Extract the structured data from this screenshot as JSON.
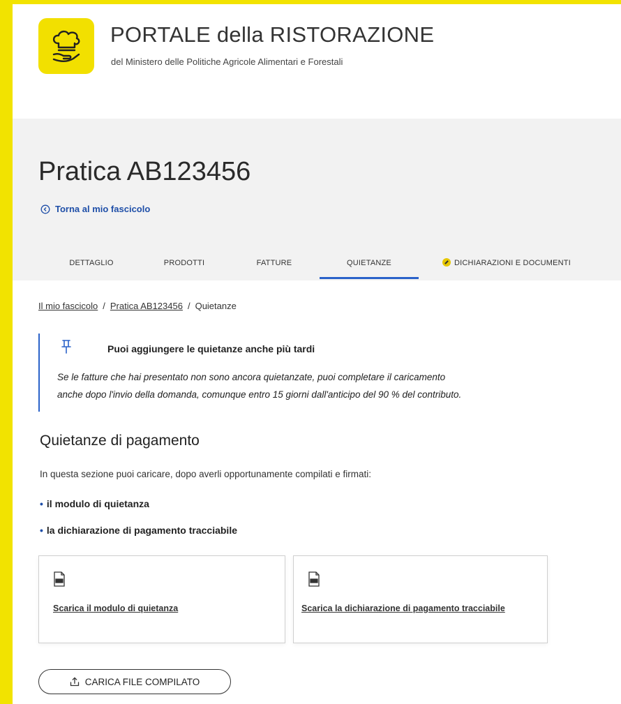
{
  "header": {
    "title": "PORTALE della RISTORAZIONE",
    "subtitle": "del Ministero delle Politiche Agricole Alimentari e Forestali"
  },
  "page": {
    "title": "Pratica AB123456",
    "back_link": "Torna al mio fascicolo"
  },
  "tabs": [
    {
      "label": "DETTAGLIO",
      "active": false
    },
    {
      "label": "PRODOTTI",
      "active": false
    },
    {
      "label": "FATTURE",
      "active": false
    },
    {
      "label": "QUIETANZE",
      "active": true
    },
    {
      "label": "DICHIARAZIONI E DOCUMENTI",
      "active": false
    }
  ],
  "breadcrumb": {
    "items": [
      "Il mio fascicolo",
      "Pratica AB123456",
      "Quietanze"
    ],
    "separator": "/"
  },
  "callout": {
    "title": "Puoi aggiungere le quietanze anche più tardi",
    "body_line1": "Se le fatture che hai presentato non sono ancora quietanzate, puoi completare il caricamento",
    "body_line2": "anche dopo l'invio della domanda, comunque entro 15 giorni dall'anticipo del 90 % del contributo."
  },
  "section": {
    "title": "Quietanze di pagamento",
    "intro": "In questa sezione puoi caricare, dopo averli opportunamente compilati e firmati:",
    "bullets": [
      "il modulo di quietanza",
      "la dichiarazione di pagamento tracciabile"
    ]
  },
  "cards": [
    {
      "link": "Scarica il modulo di quietanza"
    },
    {
      "link": "Scarica la dichiarazione di pagamento tracciabile"
    }
  ],
  "upload": {
    "label": "CARICA FILE COMPILATO"
  },
  "colors": {
    "brand_yellow": "#f2e300",
    "link_blue": "#1f4fa8",
    "tab_active": "#2a62c9"
  }
}
